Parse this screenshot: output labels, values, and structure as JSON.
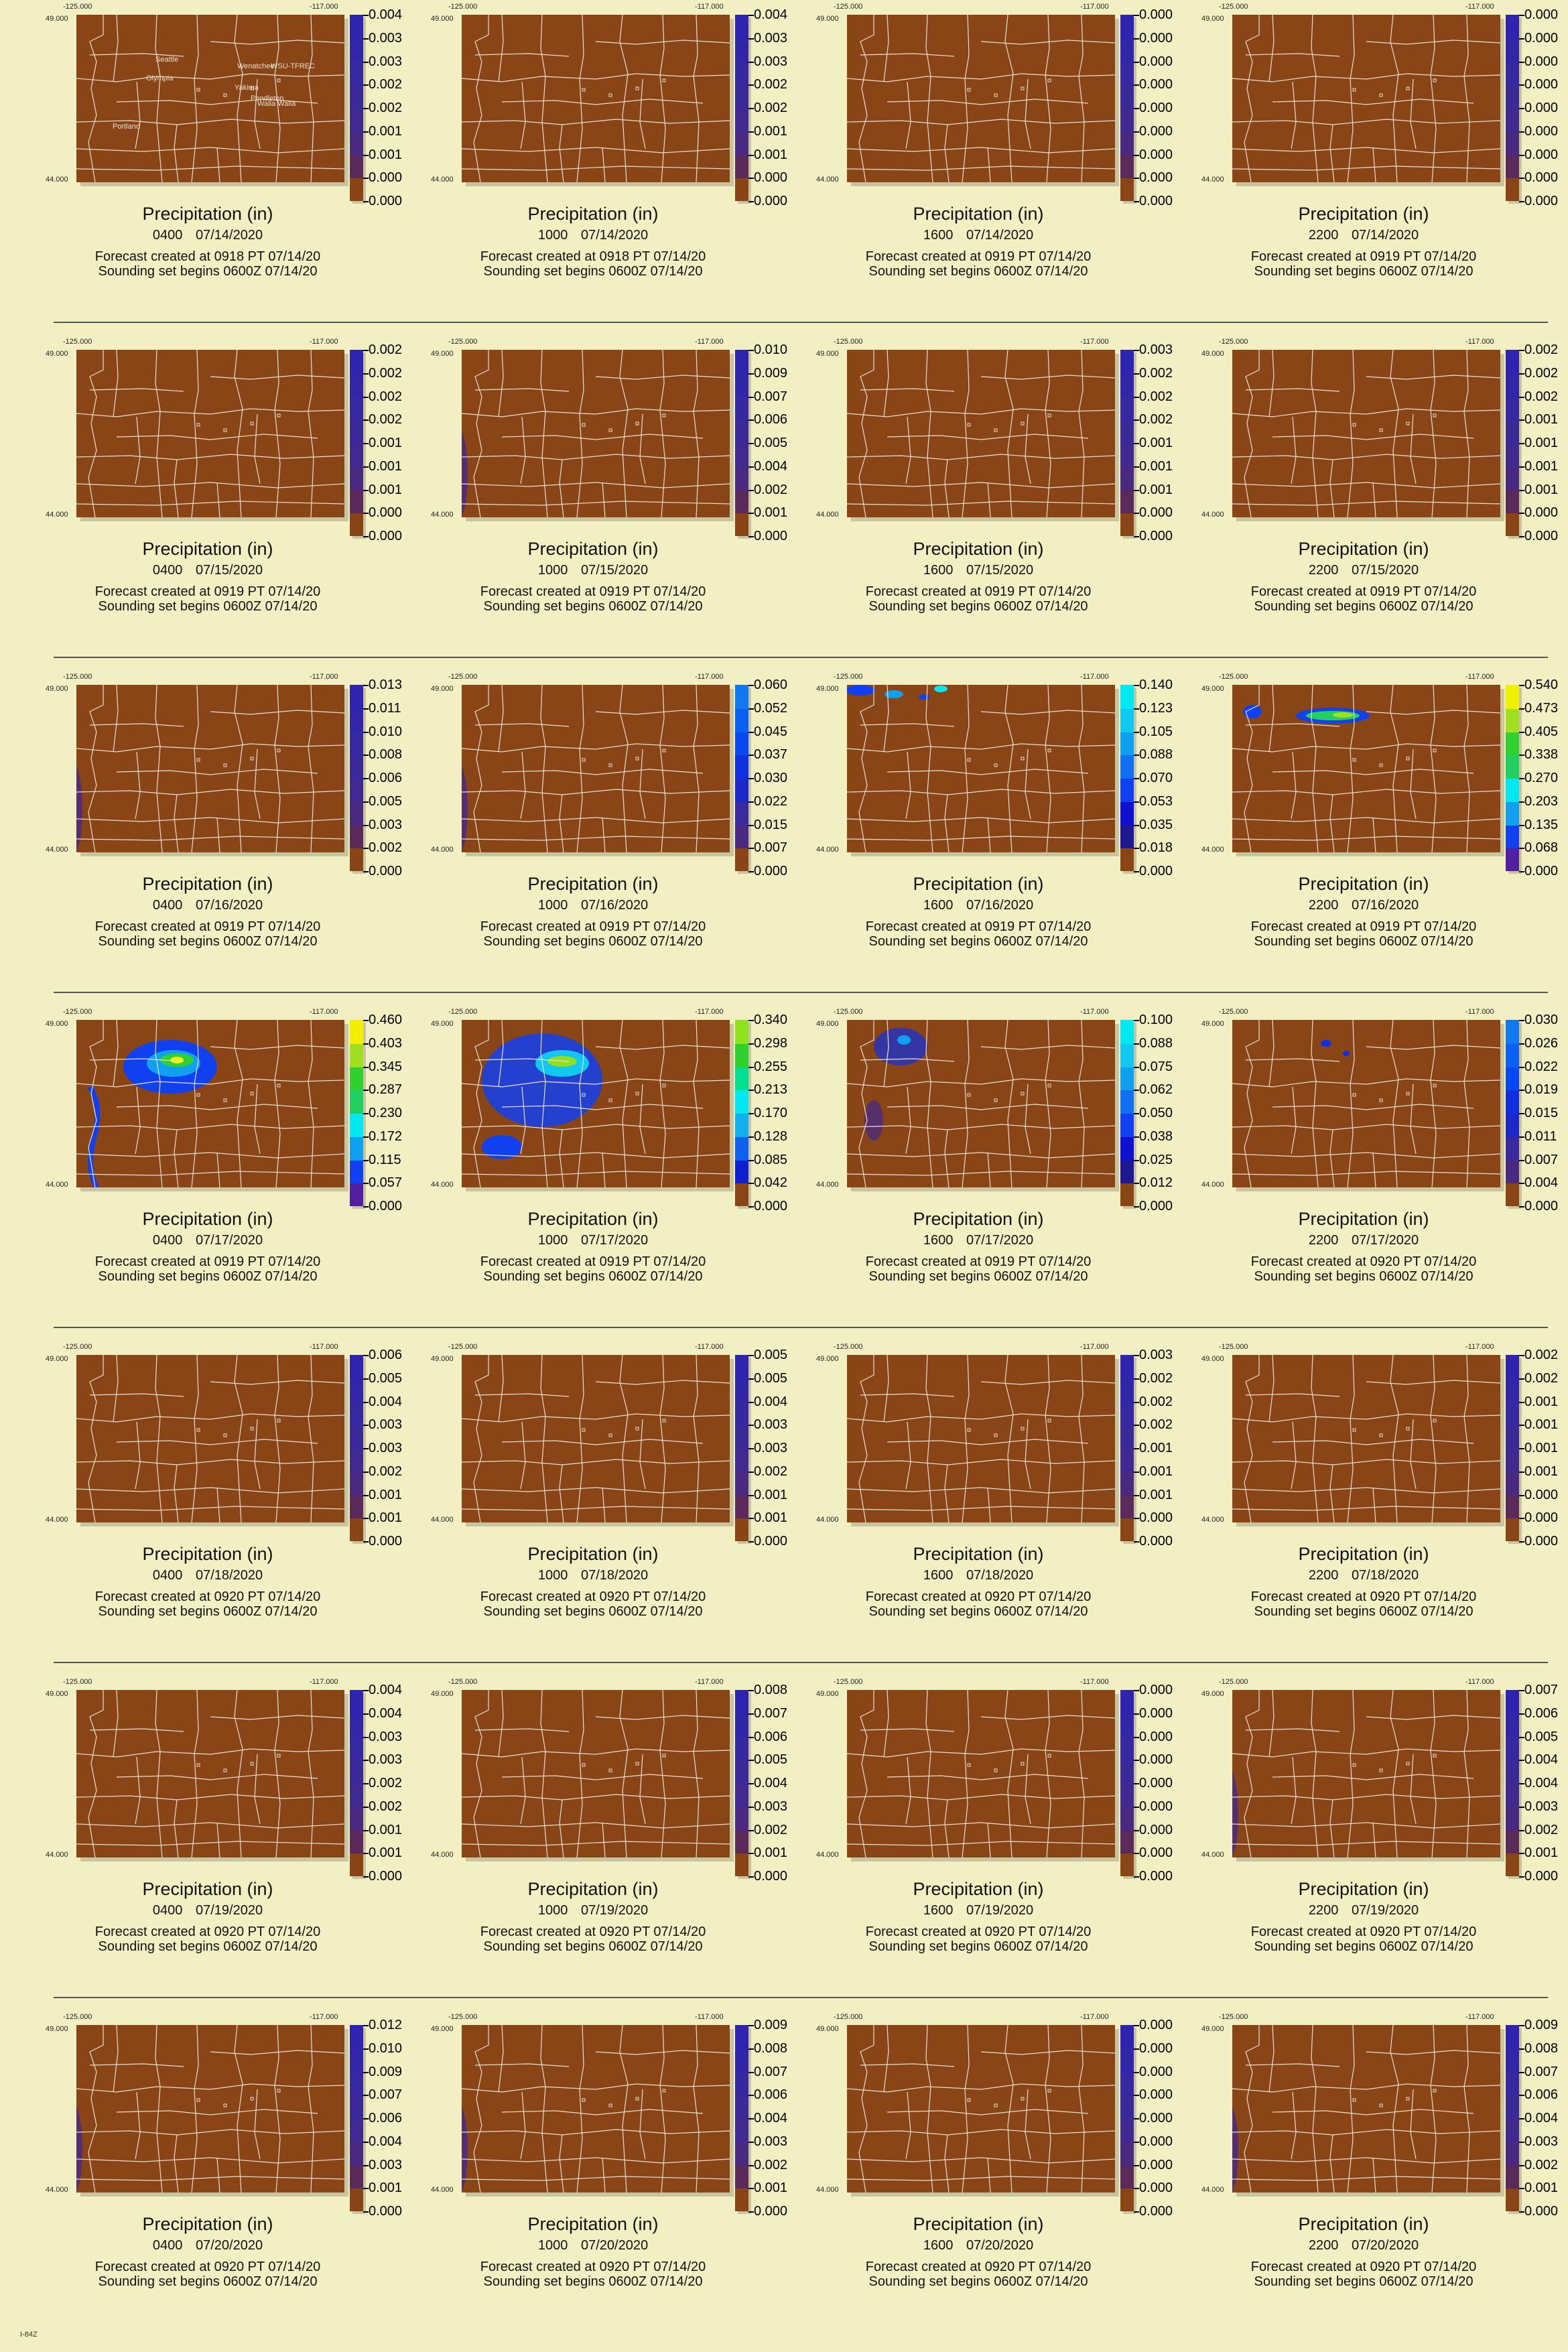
{
  "panel_title": "Precipitation (in)",
  "lon_left": "-125.000",
  "lon_right": "-117.000",
  "lat_top": "49.000",
  "lat_bottom": "44.000",
  "sounding": "Sounding set begins 0600Z 07/14/20",
  "footer": "I-84Z",
  "cities": [
    "Seattle",
    "Olympia",
    "Wenatchee",
    "WSU-TFREC",
    "Yakima",
    "Walla Walla",
    "Pendleton",
    "Portland"
  ],
  "colors": {
    "background": "#f2efc3",
    "map_zero": "#8a4516",
    "purple": "#5b2a8f",
    "blue": "#1030e0",
    "cyan": "#00e8f0",
    "green": "#22cc22",
    "yellow": "#f0f000",
    "borders": "#e8e0d0"
  },
  "rows": [
    {
      "panels": [
        {
          "hour": "0400",
          "date": "07/14/2020",
          "created": "Forecast created at 0918 PT 07/14/20",
          "scale": [
            "0.004",
            "0.003",
            "0.003",
            "0.002",
            "0.002",
            "0.001",
            "0.001",
            "0.000",
            "0.000"
          ],
          "precip": "none",
          "labels": true
        },
        {
          "hour": "1000",
          "date": "07/14/2020",
          "created": "Forecast created at 0918 PT 07/14/20",
          "scale": [
            "0.004",
            "0.003",
            "0.003",
            "0.002",
            "0.002",
            "0.001",
            "0.001",
            "0.000",
            "0.000"
          ],
          "precip": "none"
        },
        {
          "hour": "1600",
          "date": "07/14/2020",
          "created": "Forecast created at 0919 PT 07/14/20",
          "scale": [
            "0.000",
            "0.000",
            "0.000",
            "0.000",
            "0.000",
            "0.000",
            "0.000",
            "0.000",
            "0.000"
          ],
          "precip": "none"
        },
        {
          "hour": "2200",
          "date": "07/14/2020",
          "created": "Forecast created at 0919 PT 07/14/20",
          "scale": [
            "0.000",
            "0.000",
            "0.000",
            "0.000",
            "0.000",
            "0.000",
            "0.000",
            "0.000",
            "0.000"
          ],
          "precip": "none"
        }
      ]
    },
    {
      "panels": [
        {
          "hour": "0400",
          "date": "07/15/2020",
          "created": "Forecast created at 0919 PT 07/14/20",
          "scale": [
            "0.002",
            "0.002",
            "0.002",
            "0.002",
            "0.001",
            "0.001",
            "0.001",
            "0.000",
            "0.000"
          ],
          "precip": "none"
        },
        {
          "hour": "1000",
          "date": "07/15/2020",
          "created": "Forecast created at 0919 PT 07/14/20",
          "scale": [
            "0.010",
            "0.009",
            "0.007",
            "0.006",
            "0.005",
            "0.004",
            "0.002",
            "0.001",
            "0.000"
          ],
          "precip": "coast"
        },
        {
          "hour": "1600",
          "date": "07/15/2020",
          "created": "Forecast created at 0919 PT 07/14/20",
          "scale": [
            "0.003",
            "0.002",
            "0.002",
            "0.002",
            "0.001",
            "0.001",
            "0.001",
            "0.000",
            "0.000"
          ],
          "precip": "none"
        },
        {
          "hour": "2200",
          "date": "07/15/2020",
          "created": "Forecast created at 0919 PT 07/14/20",
          "scale": [
            "0.002",
            "0.002",
            "0.002",
            "0.001",
            "0.001",
            "0.001",
            "0.001",
            "0.000",
            "0.000"
          ],
          "precip": "none"
        }
      ]
    },
    {
      "panels": [
        {
          "hour": "0400",
          "date": "07/16/2020",
          "created": "Forecast created at 0919 PT 07/14/20",
          "scale": [
            "0.013",
            "0.011",
            "0.010",
            "0.008",
            "0.006",
            "0.005",
            "0.003",
            "0.002",
            "0.000"
          ],
          "precip": "coast"
        },
        {
          "hour": "1000",
          "date": "07/16/2020",
          "created": "Forecast created at 0919 PT 07/14/20",
          "scale": [
            "0.060",
            "0.052",
            "0.045",
            "0.037",
            "0.030",
            "0.022",
            "0.015",
            "0.007",
            "0.000"
          ],
          "precip": "coast",
          "cmap": "blue"
        },
        {
          "hour": "1600",
          "date": "07/16/2020",
          "created": "Forecast created at 0919 PT 07/14/20",
          "scale": [
            "0.140",
            "0.123",
            "0.105",
            "0.088",
            "0.070",
            "0.053",
            "0.035",
            "0.018",
            "0.000"
          ],
          "precip": "north",
          "cmap": "cyan"
        },
        {
          "hour": "2200",
          "date": "07/16/2020",
          "created": "Forecast created at 0919 PT 07/14/20",
          "scale": [
            "0.540",
            "0.473",
            "0.405",
            "0.338",
            "0.270",
            "0.203",
            "0.135",
            "0.068",
            "0.000"
          ],
          "precip": "northband",
          "cmap": "full"
        }
      ]
    },
    {
      "panels": [
        {
          "hour": "0400",
          "date": "07/17/2020",
          "created": "Forecast created at 0919 PT 07/14/20",
          "scale": [
            "0.460",
            "0.403",
            "0.345",
            "0.287",
            "0.230",
            "0.172",
            "0.115",
            "0.057",
            "0.000"
          ],
          "precip": "heavy",
          "cmap": "full"
        },
        {
          "hour": "1000",
          "date": "07/17/2020",
          "created": "Forecast created at 0919 PT 07/14/20",
          "scale": [
            "0.340",
            "0.298",
            "0.255",
            "0.213",
            "0.170",
            "0.128",
            "0.085",
            "0.042",
            "0.000"
          ],
          "precip": "heavy2",
          "cmap": "green"
        },
        {
          "hour": "1600",
          "date": "07/17/2020",
          "created": "Forecast created at 0919 PT 07/14/20",
          "scale": [
            "0.100",
            "0.088",
            "0.075",
            "0.062",
            "0.050",
            "0.038",
            "0.025",
            "0.012",
            "0.000"
          ],
          "precip": "light",
          "cmap": "cyan"
        },
        {
          "hour": "2200",
          "date": "07/17/2020",
          "created": "Forecast created at 0920 PT 07/14/20",
          "scale": [
            "0.030",
            "0.026",
            "0.022",
            "0.019",
            "0.015",
            "0.011",
            "0.007",
            "0.004",
            "0.000"
          ],
          "precip": "dots",
          "cmap": "blue"
        }
      ]
    },
    {
      "panels": [
        {
          "hour": "0400",
          "date": "07/18/2020",
          "created": "Forecast created at 0920 PT 07/14/20",
          "scale": [
            "0.006",
            "0.005",
            "0.004",
            "0.003",
            "0.003",
            "0.002",
            "0.001",
            "0.001",
            "0.000"
          ],
          "precip": "none"
        },
        {
          "hour": "1000",
          "date": "07/18/2020",
          "created": "Forecast created at 0920 PT 07/14/20",
          "scale": [
            "0.005",
            "0.005",
            "0.004",
            "0.003",
            "0.003",
            "0.002",
            "0.001",
            "0.001",
            "0.000"
          ],
          "precip": "none"
        },
        {
          "hour": "1600",
          "date": "07/18/2020",
          "created": "Forecast created at 0920 PT 07/14/20",
          "scale": [
            "0.003",
            "0.002",
            "0.002",
            "0.002",
            "0.001",
            "0.001",
            "0.001",
            "0.000",
            "0.000"
          ],
          "precip": "none"
        },
        {
          "hour": "2200",
          "date": "07/18/2020",
          "created": "Forecast created at 0920 PT 07/14/20",
          "scale": [
            "0.002",
            "0.002",
            "0.001",
            "0.001",
            "0.001",
            "0.001",
            "0.000",
            "0.000",
            "0.000"
          ],
          "precip": "none"
        }
      ]
    },
    {
      "panels": [
        {
          "hour": "0400",
          "date": "07/19/2020",
          "created": "Forecast created at 0920 PT 07/14/20",
          "scale": [
            "0.004",
            "0.004",
            "0.003",
            "0.003",
            "0.002",
            "0.002",
            "0.001",
            "0.001",
            "0.000"
          ],
          "precip": "none"
        },
        {
          "hour": "1000",
          "date": "07/19/2020",
          "created": "Forecast created at 0920 PT 07/14/20",
          "scale": [
            "0.008",
            "0.007",
            "0.006",
            "0.005",
            "0.004",
            "0.003",
            "0.002",
            "0.001",
            "0.000"
          ],
          "precip": "none"
        },
        {
          "hour": "1600",
          "date": "07/19/2020",
          "created": "Forecast created at 0920 PT 07/14/20",
          "scale": [
            "0.000",
            "0.000",
            "0.000",
            "0.000",
            "0.000",
            "0.000",
            "0.000",
            "0.000",
            "0.000"
          ],
          "precip": "none"
        },
        {
          "hour": "2200",
          "date": "07/19/2020",
          "created": "Forecast created at 0920 PT 07/14/20",
          "scale": [
            "0.007",
            "0.006",
            "0.005",
            "0.004",
            "0.004",
            "0.003",
            "0.002",
            "0.001",
            "0.000"
          ],
          "precip": "coast"
        }
      ]
    },
    {
      "panels": [
        {
          "hour": "0400",
          "date": "07/20/2020",
          "created": "Forecast created at 0920 PT 07/14/20",
          "scale": [
            "0.012",
            "0.010",
            "0.009",
            "0.007",
            "0.006",
            "0.004",
            "0.003",
            "0.001",
            "0.000"
          ],
          "precip": "coast"
        },
        {
          "hour": "1000",
          "date": "07/20/2020",
          "created": "Forecast created at 0920 PT 07/14/20",
          "scale": [
            "0.009",
            "0.008",
            "0.007",
            "0.006",
            "0.004",
            "0.003",
            "0.002",
            "0.001",
            "0.000"
          ],
          "precip": "coast"
        },
        {
          "hour": "1600",
          "date": "07/20/2020",
          "created": "Forecast created at 0920 PT 07/14/20",
          "scale": [
            "0.000",
            "0.000",
            "0.000",
            "0.000",
            "0.000",
            "0.000",
            "0.000",
            "0.000",
            "0.000"
          ],
          "precip": "none"
        },
        {
          "hour": "2200",
          "date": "07/20/2020",
          "created": "Forecast created at 0920 PT 07/14/20",
          "scale": [
            "0.009",
            "0.008",
            "0.007",
            "0.006",
            "0.004",
            "0.003",
            "0.002",
            "0.001",
            "0.000"
          ],
          "precip": "coast"
        }
      ]
    }
  ]
}
